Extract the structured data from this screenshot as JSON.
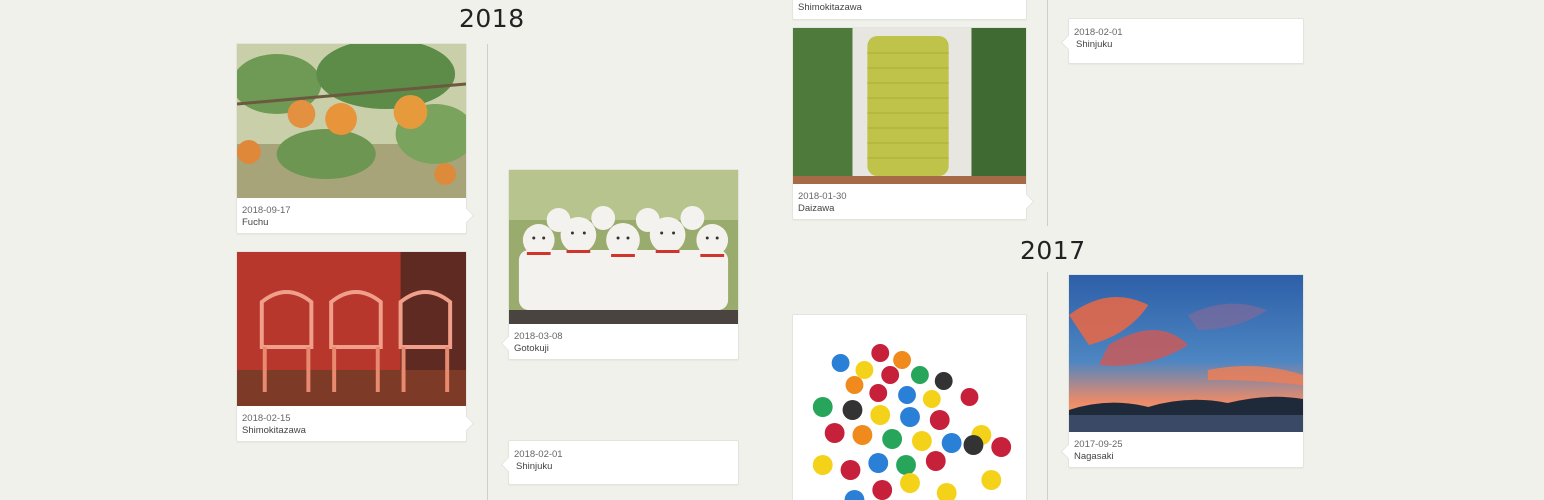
{
  "timeline": {
    "left_column": {
      "year_heading": "2018",
      "cards": [
        {
          "date": "2018-09-17",
          "place": "Fuchu"
        },
        {
          "date": "2018-02-15",
          "place": "Shimokitazawa"
        },
        {
          "date": "2018-03-08",
          "place": "Gotokuji"
        },
        {
          "date": "2018-02-01",
          "place": "Shinjuku"
        }
      ]
    },
    "right_column": {
      "top_card": {
        "place": "Shimokitazawa"
      },
      "cards": [
        {
          "date": "2018-01-30",
          "place": "Daizawa"
        },
        {
          "date": "2018-02-01",
          "place": "Shinjuku"
        }
      ],
      "year_heading_2": "2017",
      "cards_2017": [
        {
          "date": "2017-09-25",
          "place": "Nagasaki"
        }
      ]
    }
  },
  "colors": {
    "background": "#f1f1ec",
    "card": "#ffffff",
    "axis": "#cfcfca"
  },
  "photo_subjects": [
    "persimmon-tree",
    "red-plastic-chairs",
    "maneki-neko-cats",
    "yellow-shutter-door",
    "colorful-candies",
    "sunset-sky"
  ]
}
